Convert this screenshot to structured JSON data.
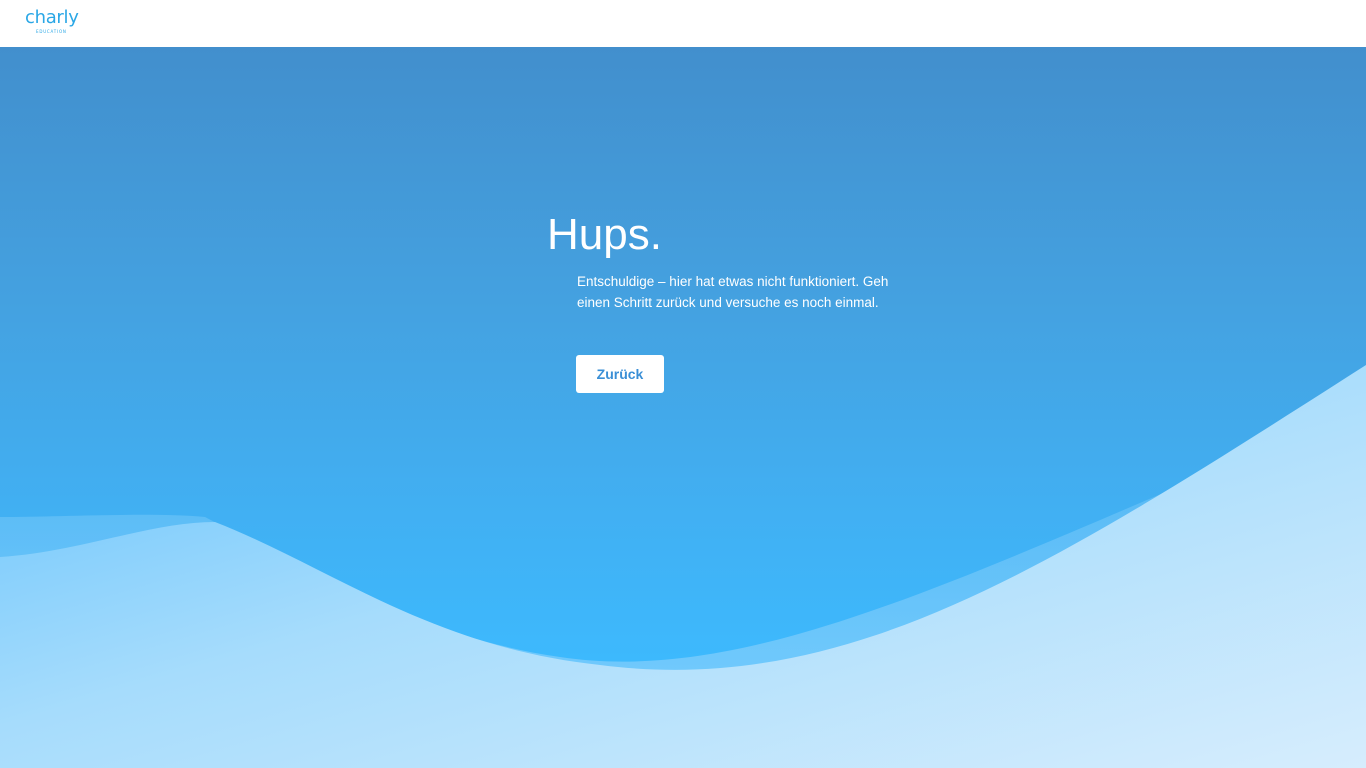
{
  "header": {
    "logo": {
      "name": "charly",
      "subtitle": "EDUCATION",
      "color": "#2aa7e6"
    }
  },
  "error": {
    "heading": "Hups.",
    "message": "Entschuldige – hier hat etwas nicht funktioniert. Geh einen Schritt zurück und versuche es noch einmal.",
    "back_button_label": "Zurück"
  },
  "colors": {
    "header_background": "#ffffff",
    "hero_top": "#428fcd",
    "hero_bottom": "#3db9fd",
    "wave_light": "#cfe9fc",
    "button_text": "#3a8fd6"
  }
}
